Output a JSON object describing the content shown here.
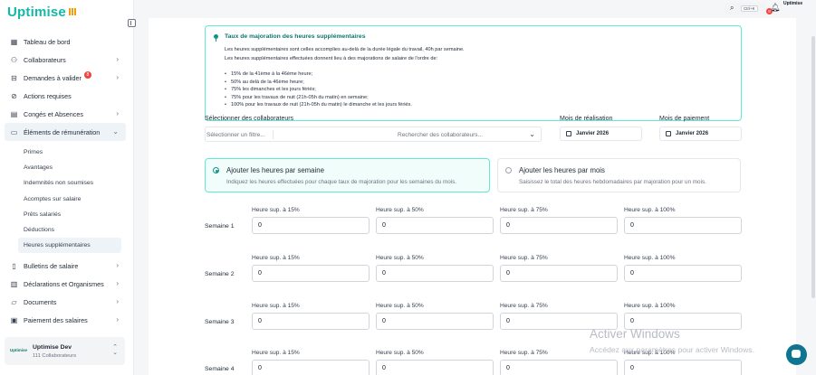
{
  "app": {
    "logo": "Uptimise"
  },
  "topbar": {
    "search_shortcut": "Ctrl+K",
    "notifications_count": "8",
    "avatar_text": "Uptimise"
  },
  "sidebar": {
    "items": [
      {
        "label": "Tableau de bord",
        "icon": "grid-icon"
      },
      {
        "label": "Collaborateurs",
        "icon": "users-icon",
        "chevron": "›"
      },
      {
        "label": "Demandes à valider",
        "icon": "inbox-icon",
        "badge": "8",
        "chevron": "›"
      },
      {
        "label": "Actions requises",
        "icon": "check-circle-icon"
      },
      {
        "label": "Congés et Absences",
        "icon": "calendar-icon",
        "chevron": "›"
      },
      {
        "label": "Éléments de rémunération",
        "icon": "card-icon",
        "chevron": "⌄"
      }
    ],
    "subitems": [
      "Primes",
      "Avantages",
      "Indemnités non soumises",
      "Acomptes sur salaire",
      "Prêts salariés",
      "Déductions",
      "Heures supplémentaires"
    ],
    "items_after": [
      {
        "label": "Bulletins de salaire",
        "icon": "file-icon",
        "chevron": "›"
      },
      {
        "label": "Déclarations et Organismes",
        "icon": "building-icon",
        "chevron": "›"
      },
      {
        "label": "Documents",
        "icon": "folder-icon",
        "chevron": "›"
      },
      {
        "label": "Paiement des salaires",
        "icon": "wallet-icon",
        "chevron": "›"
      }
    ],
    "org": {
      "name": "Uptimise Dev",
      "sub": "111 Collaborateurs",
      "mini_logo": "Uptimise"
    }
  },
  "info": {
    "title": "Taux de majoration des heures supplémentaires",
    "p1": "Les heures supplémentaires sont celles accomplies au-delà de la durée légale du travail, 40h par semaine.",
    "p2": "Les heures supplémentaires effectuées donnent lieu à des majorations de salaire de l'ordre de:",
    "list": [
      "15% de la 41ème à la 46ème heure;",
      "50% au delà de la 46ème heure;",
      "75% les dimanches et les jours fériés;",
      "75% pour les travaux de nuit (21h-05h du matin) en semaine;",
      "100% pour les travaux de nuit (21h-05h du matin) le dimanche et les jours fériés."
    ]
  },
  "filters": {
    "collab_label": "Sélectionner des collaborateurs",
    "filter_placeholder": "Sélectionner un filtre...",
    "search_placeholder": "Rechercher des collaborateurs...",
    "realisation_label": "Mois de réalisation",
    "realisation_value": "Janvier 2026",
    "paiement_label": "Mois de paiement",
    "paiement_value": "Janvier 2026"
  },
  "modes": {
    "week": {
      "title": "Ajouter les heures par semaine",
      "desc": "Indiquez les heures effectuées pour chaque taux de majoration pour les semaines du mois."
    },
    "month": {
      "title": "Ajouter les heures par mois",
      "desc": "Saisissez le total des heures hebdomadaires par majoration pour un mois."
    }
  },
  "fields": [
    "Heure sup. à 15%",
    "Heure sup. à 50%",
    "Heure sup. à 75%",
    "Heure sup. à 100%"
  ],
  "weeks": [
    {
      "label": "Semaine 1",
      "values": [
        "0",
        "0",
        "0",
        "0"
      ]
    },
    {
      "label": "Semaine 2",
      "values": [
        "0",
        "0",
        "0",
        "0"
      ]
    },
    {
      "label": "Semaine 3",
      "values": [
        "0",
        "0",
        "0",
        "0"
      ]
    },
    {
      "label": "Semaine 4",
      "values": [
        "0",
        "0",
        "0",
        "0"
      ]
    }
  ],
  "watermark": {
    "line1": "Activer Windows",
    "line2": "Accédez aux paramètres pour activer Windows."
  }
}
